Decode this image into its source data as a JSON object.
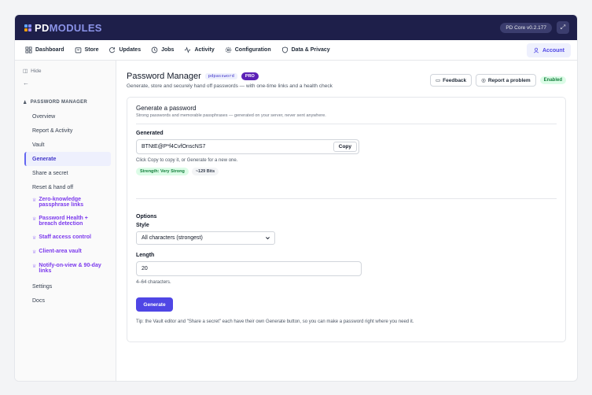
{
  "brand": {
    "pd": "PD",
    "modules": "MODULES",
    "mark_colors": [
      "#60a5fa",
      "#818cf8",
      "#f59e0b",
      "#a78bfa"
    ]
  },
  "topbar": {
    "version": "PD Core v0.2.177",
    "expand_icon": "expand-icon"
  },
  "nav": {
    "items": [
      {
        "label": "Dashboard",
        "icon": "dashboard-icon"
      },
      {
        "label": "Store",
        "icon": "store-icon"
      },
      {
        "label": "Updates",
        "icon": "refresh-icon"
      },
      {
        "label": "Jobs",
        "icon": "clock-icon"
      },
      {
        "label": "Activity",
        "icon": "activity-icon"
      },
      {
        "label": "Configuration",
        "icon": "gear-icon"
      },
      {
        "label": "Data & Privacy",
        "icon": "shield-icon"
      }
    ],
    "account": "Account"
  },
  "sidebar": {
    "hide": "Hide",
    "back": "←",
    "section": "PASSWORD MANAGER",
    "items": [
      {
        "label": "Overview",
        "pro": false
      },
      {
        "label": "Report & Activity",
        "pro": false
      },
      {
        "label": "Vault",
        "pro": false
      },
      {
        "label": "Generate",
        "pro": false,
        "active": true
      },
      {
        "label": "Share a secret",
        "pro": false
      },
      {
        "label": "Reset & hand off",
        "pro": false
      },
      {
        "label": "Zero-knowledge passphrase links",
        "pro": true
      },
      {
        "label": "Password Health + breach detection",
        "pro": true
      },
      {
        "label": "Staff access control",
        "pro": true
      },
      {
        "label": "Client-area vault",
        "pro": true
      },
      {
        "label": "Notify-on-view & 90-day links",
        "pro": true
      },
      {
        "label": "Settings",
        "pro": false
      },
      {
        "label": "Docs",
        "pro": false
      }
    ]
  },
  "page": {
    "title": "Password Manager",
    "slug": "pdpassword",
    "pro": "PRO",
    "subtitle": "Generate, store and securely hand off passwords — with one-time links and a health check",
    "feedback": "Feedback",
    "report": "Report a problem",
    "status": "Enabled"
  },
  "card": {
    "title": "Generate a password",
    "subtitle": "Strong passwords and memorable passphrases — generated on your server, never sent anywhere.",
    "generated_label": "Generated",
    "generated_value": "BTNtE@P*f4CvfOnscNS7",
    "copy": "Copy",
    "copy_hint": "Click Copy to copy it, or Generate for a new one.",
    "strength": "Strength: Very Strong",
    "bits": "~129 Bits",
    "options_label": "Options",
    "style_label": "Style",
    "style_value": "All characters (strongest)",
    "length_label": "Length",
    "length_value": "20",
    "length_hint": "4–64 characters.",
    "generate": "Generate",
    "tip": "Tip: the Vault editor and \"Share a secret\" each have their own Generate button, so you can make a password right where you need it."
  },
  "colors": {
    "topbar": "#1e1f4a",
    "accent": "#4f46e5",
    "pro": "#7c3aed",
    "success": "#15803d"
  }
}
